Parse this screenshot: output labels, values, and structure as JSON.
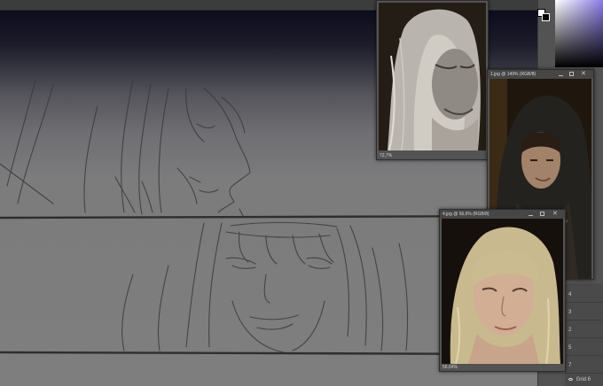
{
  "doc_windows": [
    {
      "title": "",
      "zoom": "72,7%",
      "image": "grey-haired-man-portrait"
    },
    {
      "title": "1.jpg @ 149% (RGB/8)",
      "zoom": "",
      "image": "hooded-woman-portrait"
    },
    {
      "title": "4.jpg @ 56,6% (RGB/8)",
      "zoom": "56,64%",
      "image": "blonde-girl-portrait"
    }
  ],
  "layers": [
    "4",
    "3",
    "2",
    "5",
    "7",
    "Grid 6"
  ],
  "colors": {
    "canvas_top": "#0c0c1c",
    "canvas_bottom": "#7e7e7e",
    "panel": "#535353",
    "picker_hue": "#8a7ce8"
  }
}
